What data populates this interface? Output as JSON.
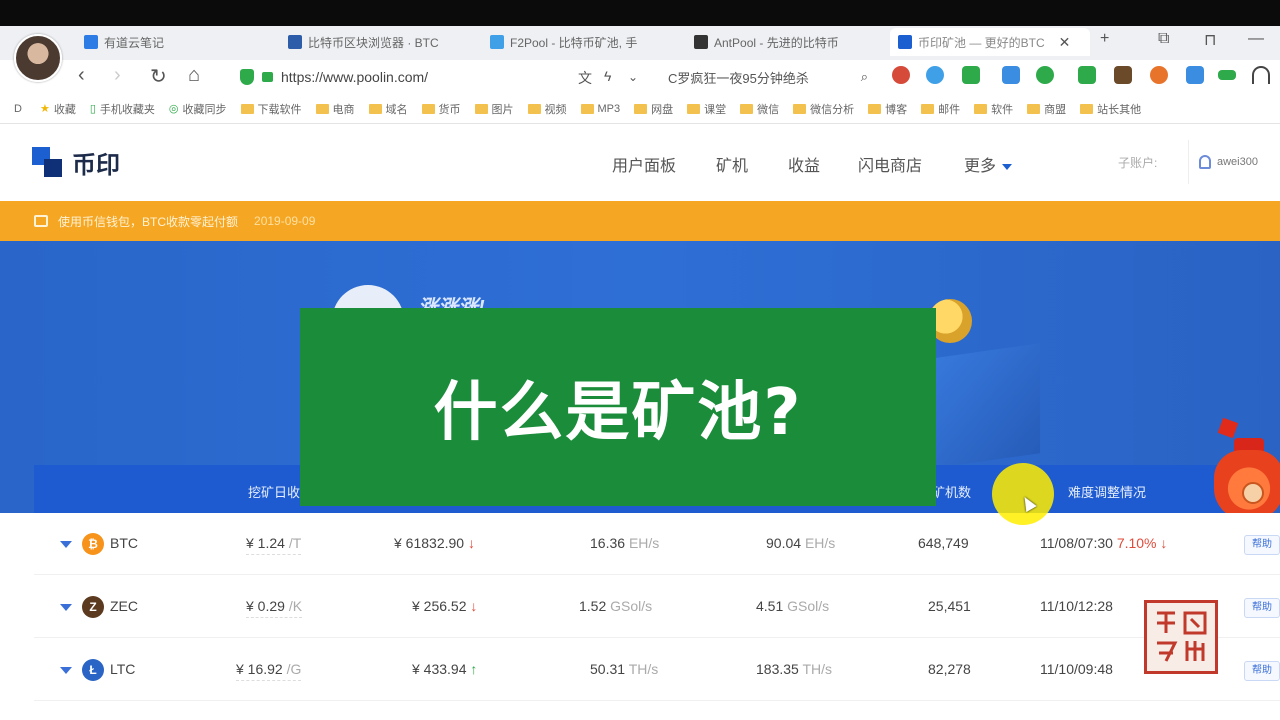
{
  "browser": {
    "tabs": [
      {
        "label": "有道云笔记",
        "color": "#2d7be5"
      },
      {
        "label": "比特币区块浏览器 · BTC",
        "color": "#2d5ca8"
      },
      {
        "label": "F2Pool - 比特币矿池, 手",
        "color": "#3fa0e8"
      },
      {
        "label": "AntPool - 先进的比特币",
        "color": "#333333"
      },
      {
        "label": "币印矿池 — 更好的BTC",
        "color": "#1b5fd0"
      }
    ],
    "url": "https://www.poolin.com/",
    "search_text": "C罗疯狂一夜95分钟绝杀"
  },
  "bookmarks": [
    {
      "label": "收藏",
      "icon": "star-icon"
    },
    {
      "label": "手机收藏夹",
      "icon": "phone-icon"
    },
    {
      "label": "收藏同步",
      "icon": "sync-icon"
    },
    {
      "label": "下载软件",
      "icon": "folder-icon"
    },
    {
      "label": "电商",
      "icon": "folder-icon"
    },
    {
      "label": "域名",
      "icon": "folder-icon"
    },
    {
      "label": "货币",
      "icon": "folder-icon"
    },
    {
      "label": "图片",
      "icon": "folder-icon"
    },
    {
      "label": "视频",
      "icon": "folder-icon"
    },
    {
      "label": "MP3",
      "icon": "folder-icon"
    },
    {
      "label": "网盘",
      "icon": "folder-icon"
    },
    {
      "label": "课堂",
      "icon": "folder-icon"
    },
    {
      "label": "微信",
      "icon": "folder-icon"
    },
    {
      "label": "微信分析",
      "icon": "folder-icon"
    },
    {
      "label": "博客",
      "icon": "folder-icon"
    },
    {
      "label": "邮件",
      "icon": "folder-icon"
    },
    {
      "label": "软件",
      "icon": "folder-icon"
    },
    {
      "label": "商盟",
      "icon": "folder-icon"
    },
    {
      "label": "站长其他",
      "icon": "folder-icon"
    }
  ],
  "site": {
    "logo_text": "币印",
    "nav": [
      "用户面板",
      "矿机",
      "收益",
      "闪电商店",
      "更多"
    ],
    "sub_account_label": "子账户:",
    "username": "awei300",
    "notice": "使用币信钱包，BTC收款零起付额",
    "notice_date": "2019-09-09",
    "hero_title": "涨涨涨!",
    "band_labels": [
      "挖矿日收益",
      "矿机数",
      "难度调整情况"
    ]
  },
  "overlay": {
    "title": "什么是矿池?"
  },
  "table": {
    "rows": [
      {
        "coin": "BTC",
        "icon_char": "₿",
        "icon_color": "#f7931a",
        "price_per": "¥ 1.24",
        "price_unit": "/T",
        "price": "¥ 61832.90",
        "price_dir": "↓",
        "pool_hash": "16.36",
        "pool_unit": "EH/s",
        "net_hash": "90.04",
        "net_unit": "EH/s",
        "workers": "648,749",
        "difficulty_time": "11/08/07:30",
        "difficulty_change": "7.10%",
        "difficulty_dir": "↓",
        "action": "帮助"
      },
      {
        "coin": "ZEC",
        "icon_char": "Z",
        "icon_color": "#5b3a1f",
        "price_per": "¥ 0.29",
        "price_unit": "/K",
        "price": "¥ 256.52",
        "price_dir": "↓",
        "pool_hash": "1.52",
        "pool_unit": "GSol/s",
        "net_hash": "4.51",
        "net_unit": "GSol/s",
        "workers": "25,451",
        "difficulty_time": "11/10/12:28",
        "difficulty_change": "",
        "difficulty_dir": "",
        "action": "帮助"
      },
      {
        "coin": "LTC",
        "icon_char": "Ł",
        "icon_color": "#2a64c5",
        "price_per": "¥ 16.92",
        "price_unit": "/G",
        "price": "¥ 433.94",
        "price_dir": "↑",
        "pool_hash": "50.31",
        "pool_unit": "TH/s",
        "net_hash": "183.35",
        "net_unit": "TH/s",
        "workers": "82,278",
        "difficulty_time": "11/10/09:48",
        "difficulty_change": "",
        "difficulty_dir": "",
        "action": "帮助"
      }
    ]
  },
  "watermark": {
    "seal_text": "阿威老师"
  }
}
